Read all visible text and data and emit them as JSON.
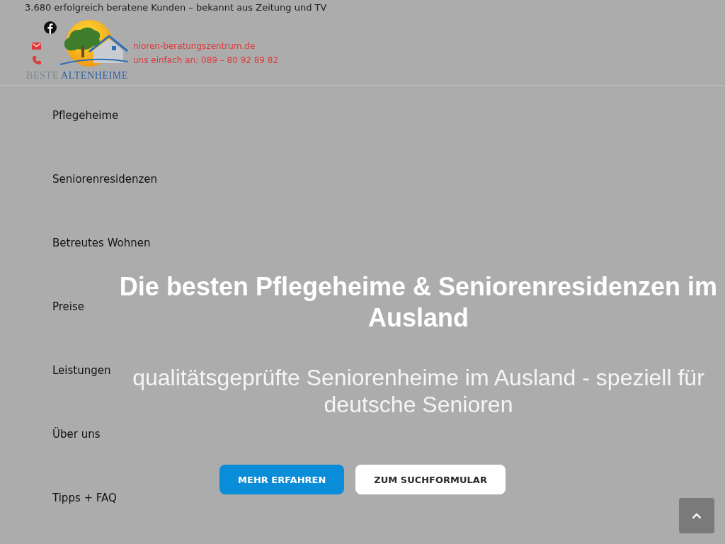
{
  "top_bar": {
    "text": "3.680 erfolgreich beratene Kunden – bekannt aus Zeitung und TV"
  },
  "header": {
    "contacts": [
      {
        "kind": "email",
        "text": "nioren-beratungszentrum.de"
      },
      {
        "kind": "phone",
        "text": "uns einfach an: 089 – 80 92 89 82"
      }
    ],
    "logo": {
      "word_1": "BESTE",
      "word_2": "ALTENHEIME"
    }
  },
  "nav": {
    "items": [
      {
        "label": "Pflegeheime"
      },
      {
        "label": "Seniorenresidenzen"
      },
      {
        "label": "Betreutes Wohnen"
      },
      {
        "label": "Preise"
      },
      {
        "label": "Leistungen"
      },
      {
        "label": "Über uns"
      },
      {
        "label": "Tipps + FAQ"
      }
    ]
  },
  "hero": {
    "title": "Die besten Pflegeheime & Seniorenresidenzen im Ausland",
    "subtitle": "qualitätsgeprüfte Seniorenheime im Ausland - speziell für deutsche Senioren",
    "buttons": [
      {
        "kind": "primary",
        "label": "MEHR ERFAHREN"
      },
      {
        "kind": "secondary",
        "label": "ZUM SUCHFORMULAR"
      }
    ]
  }
}
